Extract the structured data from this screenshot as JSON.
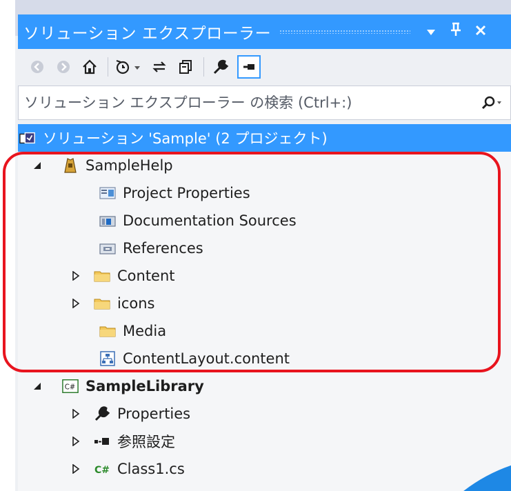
{
  "window": {
    "title": "ソリューション エクスプローラー",
    "dropdown_glyph": "▼",
    "pin_glyph": "ᵠ",
    "close_glyph": "✕"
  },
  "toolbar": {
    "items": [
      "back-icon",
      "forward-icon",
      "home-icon",
      "history-icon",
      "sync-icon",
      "copy-icon",
      "wrench-icon",
      "pin-toggle-icon"
    ]
  },
  "search": {
    "placeholder": "ソリューション エクスプローラー の検索 (Ctrl+:)",
    "value": ""
  },
  "tree": {
    "solution": "ソリューション 'Sample' (2 プロジェクト)",
    "project1": {
      "name": "SampleHelp",
      "children": [
        "Project Properties",
        "Documentation Sources",
        "References",
        "Content",
        "icons",
        "Media",
        "ContentLayout.content"
      ]
    },
    "project2": {
      "name": "SampleLibrary",
      "children": [
        "Properties",
        "参照設定",
        "Class1.cs"
      ]
    }
  },
  "colors": {
    "accent": "#3399ff",
    "highlight": "#e8141e",
    "folder": "#f3c85a",
    "text": "#1e1e1e"
  }
}
